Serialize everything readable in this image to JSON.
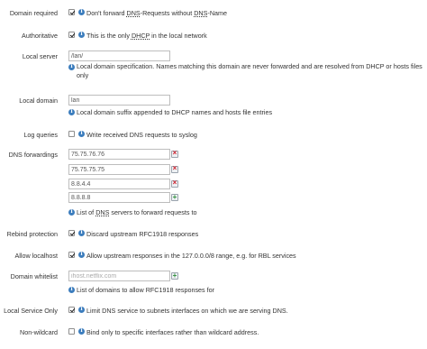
{
  "rows": {
    "domain_required": {
      "label": "Domain required",
      "checked": true,
      "text_pre": "Don't forward ",
      "abbr1": "DNS",
      "text_mid": "-Requests without ",
      "abbr2": "DNS",
      "text_post": "-Name"
    },
    "authoritative": {
      "label": "Authoritative",
      "checked": true,
      "text_pre": "This is the only ",
      "abbr": "DHCP",
      "text_post": " in the local network"
    },
    "local_server": {
      "label": "Local server",
      "value": "/lan/",
      "description": "Local domain specification. Names matching this domain are never forwarded and are resolved from DHCP or hosts files only"
    },
    "local_domain": {
      "label": "Local domain",
      "value": "lan",
      "description": "Local domain suffix appended to DHCP names and hosts file entries"
    },
    "log_queries": {
      "label": "Log queries",
      "checked": false,
      "text": "Write received DNS requests to syslog"
    },
    "dns_forwardings": {
      "label": "DNS forwardings",
      "entries": [
        "75.75.76.76",
        "75.75.75.75",
        "8.8.4.4",
        "8.8.8.8"
      ],
      "desc_pre": "List of ",
      "desc_abbr": "DNS",
      "desc_post": " servers to forward requests to"
    },
    "rebind_protection": {
      "label": "Rebind protection",
      "checked": true,
      "text": "Discard upstream RFC1918 responses"
    },
    "allow_localhost": {
      "label": "Allow localhost",
      "checked": true,
      "text": "Allow upstream responses in the 127.0.0.0/8 range, e.g. for RBL services"
    },
    "domain_whitelist": {
      "label": "Domain whitelist",
      "value": "",
      "placeholder": "ihost.netflix.com",
      "description": "List of domains to allow RFC1918 responses for"
    },
    "local_service_only": {
      "label": "Local Service Only",
      "checked": true,
      "text": "Limit DNS service to subnets interfaces on which we are serving DNS."
    },
    "non_wildcard": {
      "label": "Non-wildcard",
      "checked": false,
      "text": "Bind only to specific interfaces rather than wildcard address."
    }
  },
  "colors": {
    "info_icon": "#3c7dbd",
    "remove_icon": "#d11f2b",
    "add_icon": "#2e8f3a"
  }
}
